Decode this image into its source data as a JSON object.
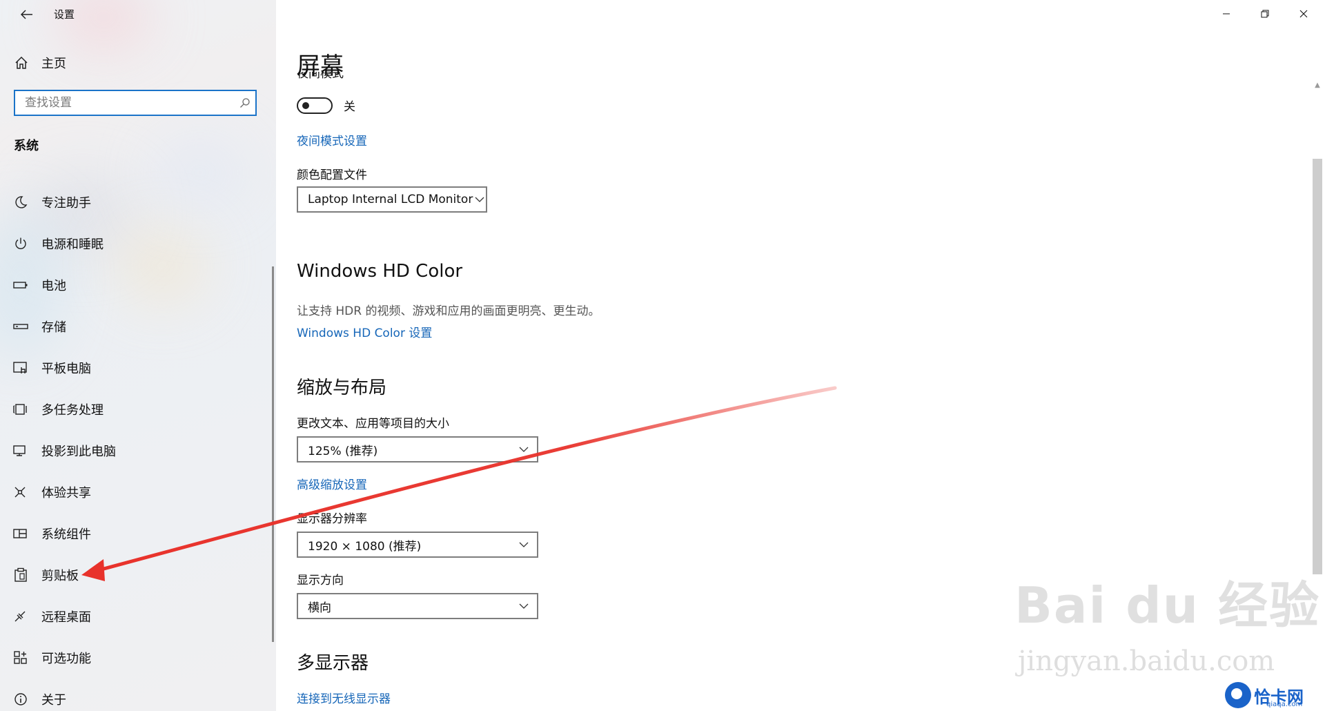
{
  "window": {
    "app_title": "设置",
    "back_icon": "arrow-left-icon",
    "controls": [
      "minimize-icon",
      "restore-icon",
      "close-icon"
    ]
  },
  "sidebar": {
    "home_label": "主页",
    "search_placeholder": "查找设置",
    "section_title": "系统",
    "items": [
      {
        "label": "专注助手",
        "icon": "moon-icon"
      },
      {
        "label": "电源和睡眠",
        "icon": "power-icon"
      },
      {
        "label": "电池",
        "icon": "battery-icon"
      },
      {
        "label": "存储",
        "icon": "storage-icon"
      },
      {
        "label": "平板电脑",
        "icon": "tablet-icon"
      },
      {
        "label": "多任务处理",
        "icon": "multitask-icon"
      },
      {
        "label": "投影到此电脑",
        "icon": "project-icon"
      },
      {
        "label": "体验共享",
        "icon": "share-icon"
      },
      {
        "label": "系统组件",
        "icon": "components-icon"
      },
      {
        "label": "剪贴板",
        "icon": "clipboard-icon"
      },
      {
        "label": "远程桌面",
        "icon": "remote-desktop-icon"
      },
      {
        "label": "可选功能",
        "icon": "optional-features-icon"
      },
      {
        "label": "关于",
        "icon": "info-icon"
      }
    ]
  },
  "main": {
    "page_title": "屏幕",
    "night_light": {
      "label": "夜间模式",
      "state": "关",
      "settings_link": "夜间模式设置"
    },
    "color_profile": {
      "label": "颜色配置文件",
      "value": "Laptop Internal LCD Monitor"
    },
    "hdr": {
      "heading": "Windows HD Color",
      "description": "让支持 HDR 的视频、游戏和应用的画面更明亮、更生动。",
      "link": "Windows HD Color 设置"
    },
    "scale_layout": {
      "heading": "缩放与布局",
      "scale_label": "更改文本、应用等项目的大小",
      "scale_value": "125% (推荐)",
      "advanced_link": "高级缩放设置",
      "resolution_label": "显示器分辨率",
      "resolution_value": "1920 × 1080 (推荐)",
      "orientation_label": "显示方向",
      "orientation_value": "横向"
    },
    "multi_display": {
      "heading": "多显示器",
      "link": "连接到无线显示器"
    }
  },
  "overlays": {
    "annotation_color": "#e8322b",
    "watermark": "Bai du 经验",
    "watermark_url": "jingyan.baidu.com",
    "brand": "恰卡网",
    "brand_sub": "qiaqa.com"
  }
}
